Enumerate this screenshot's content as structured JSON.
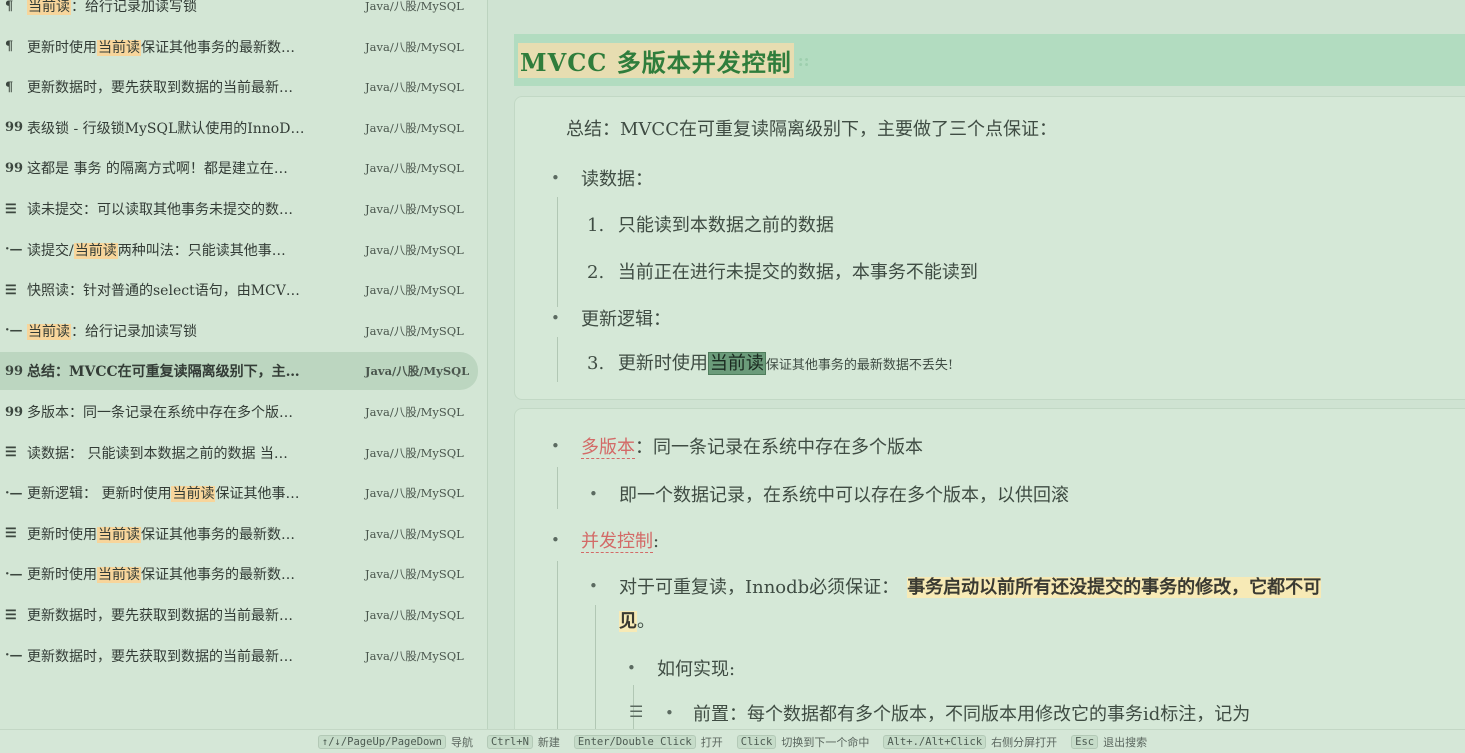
{
  "results": [
    {
      "icon": "¶",
      "parts": [
        {
          "t": "当前读",
          "hl": true
        },
        {
          "t": "：给行记录加读写锁"
        }
      ],
      "path": "Java/八股/MySQL"
    },
    {
      "icon": "¶",
      "parts": [
        {
          "t": "更新时使用"
        },
        {
          "t": "当前读",
          "hl": true
        },
        {
          "t": "保证其他事务的最新数…"
        }
      ],
      "path": "Java/八股/MySQL"
    },
    {
      "icon": "¶",
      "parts": [
        {
          "t": "更新数据时，要先获取到数据的当前最新…"
        }
      ],
      "path": "Java/八股/MySQL"
    },
    {
      "icon": "99",
      "parts": [
        {
          "t": "表级锁 - 行级锁MySQL默认使用的InnoD…"
        }
      ],
      "path": "Java/八股/MySQL"
    },
    {
      "icon": "99",
      "parts": [
        {
          "t": "这都是 事务 的隔离方式啊！都是建立在…"
        }
      ],
      "path": "Java/八股/MySQL"
    },
    {
      "icon": "☰",
      "parts": [
        {
          "t": "读未提交：可以读取其他事务未提交的数…"
        }
      ],
      "path": "Java/八股/MySQL"
    },
    {
      "icon": "·—",
      "parts": [
        {
          "t": "读提交/"
        },
        {
          "t": "当前读",
          "hl": true
        },
        {
          "t": "两种叫法：只能读其他事…"
        }
      ],
      "path": "Java/八股/MySQL"
    },
    {
      "icon": "☰",
      "parts": [
        {
          "t": "快照读：针对普通的select语句，由MCV…"
        }
      ],
      "path": "Java/八股/MySQL"
    },
    {
      "icon": "·—",
      "parts": [
        {
          "t": "当前读",
          "hl": true
        },
        {
          "t": "：给行记录加读写锁"
        }
      ],
      "path": "Java/八股/MySQL"
    },
    {
      "icon": "99",
      "parts": [
        {
          "t": "总结：MVCC在可重复读隔离级别下，主…"
        }
      ],
      "path": "Java/八股/MySQL",
      "active": true
    },
    {
      "icon": "99",
      "parts": [
        {
          "t": "多版本：同一条记录在系统中存在多个版…"
        }
      ],
      "path": "Java/八股/MySQL"
    },
    {
      "icon": "☰",
      "parts": [
        {
          "t": "读数据： 只能读到本数据之前的数据 当…"
        }
      ],
      "path": "Java/八股/MySQL"
    },
    {
      "icon": "·—",
      "parts": [
        {
          "t": "更新逻辑： 更新时使用"
        },
        {
          "t": "当前读",
          "hl": true
        },
        {
          "t": "保证其他事…"
        }
      ],
      "path": "Java/八股/MySQL"
    },
    {
      "icon": "☰",
      "parts": [
        {
          "t": "更新时使用"
        },
        {
          "t": "当前读",
          "hl": true
        },
        {
          "t": "保证其他事务的最新数…"
        }
      ],
      "path": "Java/八股/MySQL"
    },
    {
      "icon": "·—",
      "parts": [
        {
          "t": "更新时使用"
        },
        {
          "t": "当前读",
          "hl": true
        },
        {
          "t": "保证其他事务的最新数…"
        }
      ],
      "path": "Java/八股/MySQL"
    },
    {
      "icon": "☰",
      "parts": [
        {
          "t": "更新数据时，要先获取到数据的当前最新…"
        }
      ],
      "path": "Java/八股/MySQL"
    },
    {
      "icon": "·—",
      "parts": [
        {
          "t": "更新数据时，要先获取到数据的当前最新…"
        }
      ],
      "path": "Java/八股/MySQL"
    }
  ],
  "editor": {
    "heading": "MVCC 多版本并发控制",
    "heading_mark": "::",
    "summary": "总结：MVCC在可重复读隔离级别下，主要做了三个点保证：",
    "read_data": "读数据：",
    "item1_num": "1.",
    "item1": "只能读到本数据之前的数据",
    "item2_num": "2.",
    "item2": "当前正在进行未提交的数据，本事务不能读到",
    "update_logic": "更新逻辑：",
    "item3_num": "3.",
    "item3_a": "更新时使用",
    "item3_hl": "当前读",
    "item3_b": "保证其他事务的最新数据不丢失!",
    "multi_version": "多版本",
    "multi_version_rest": "：同一条记录在系统中存在多个版本",
    "multi_sub": "即一个数据记录，在系统中可以存在多个版本，以供回滚",
    "concurrency": "并发控制",
    "colon": ":",
    "rr_a": "对于可重复读，Innodb必须保证：",
    "rr_hl1": "事务启动以前所有还没提交的事务的修改，它都不可",
    "rr_hl2": "见",
    "rr_end": "。",
    "how": "如何实现:",
    "prereq": "前置：每个数据都有多个版本，不同版本用修改它的事务id标注，记为"
  },
  "hints": [
    {
      "key": "↑/↓/PageUp/PageDown",
      "label": "导航"
    },
    {
      "key": "Ctrl+N",
      "label": "新建"
    },
    {
      "key": "Enter/Double Click",
      "label": "打开"
    },
    {
      "key": "Click",
      "label": "切换到下一个命中"
    },
    {
      "key": "Alt+./Alt+Click",
      "label": "右侧分屏打开"
    },
    {
      "key": "Esc",
      "label": "退出搜索"
    }
  ]
}
